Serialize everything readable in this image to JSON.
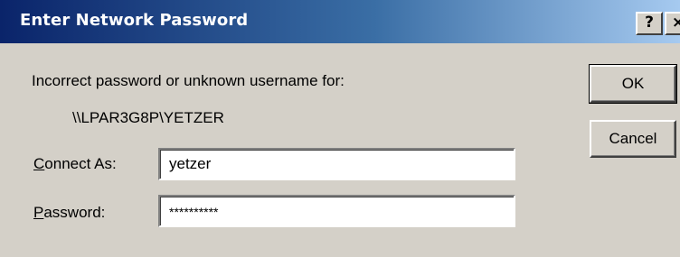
{
  "window": {
    "title": "Enter Network Password",
    "help_glyph": "?",
    "close_glyph": "×"
  },
  "message": {
    "text": "Incorrect password or unknown username for:",
    "resource_path": "\\\\LPAR3G8P\\YETZER"
  },
  "form": {
    "connect_as": {
      "label_mnemonic": "C",
      "label_rest": "onnect As:",
      "value": "yetzer"
    },
    "password": {
      "label_mnemonic": "P",
      "label_rest": "assword:",
      "value": "**********"
    }
  },
  "buttons": {
    "ok_label": "OK",
    "cancel_label": "Cancel"
  },
  "colors": {
    "title_gradient_start": "#0a246a",
    "title_gradient_end": "#a6caf0",
    "dialog_face": "#d4d0c8"
  }
}
